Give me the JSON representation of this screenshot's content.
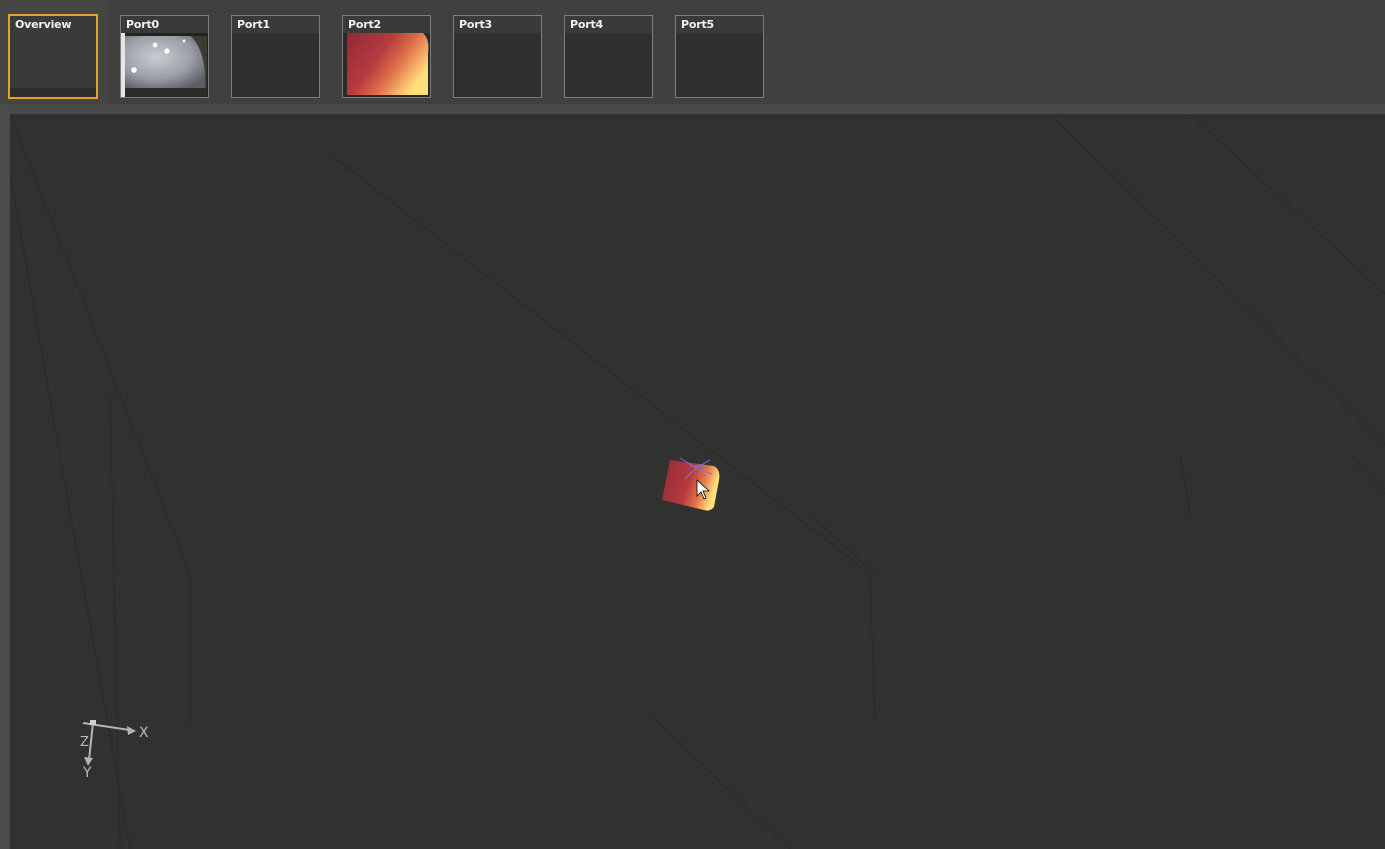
{
  "tabs": [
    {
      "label": "Overview",
      "active": true,
      "preview": "empty"
    },
    {
      "label": "Port0",
      "active": false,
      "preview": "camera-ceiling-lights"
    },
    {
      "label": "Port1",
      "active": false,
      "preview": "empty"
    },
    {
      "label": "Port2",
      "active": false,
      "preview": "thermal-gradient"
    },
    {
      "label": "Port3",
      "active": false,
      "preview": "empty"
    },
    {
      "label": "Port4",
      "active": false,
      "preview": "empty"
    },
    {
      "label": "Port5",
      "active": false,
      "preview": "empty"
    }
  ],
  "axes": {
    "x_label": "X",
    "y_label": "Y",
    "z_label": "Z"
  },
  "colors": {
    "active_tab_border": "#e0a42a",
    "viewport_background": "#313130",
    "thermal_start": "#8e2a3a",
    "thermal_end": "#ffe07a",
    "frustum_lines": "#6a78ff"
  }
}
